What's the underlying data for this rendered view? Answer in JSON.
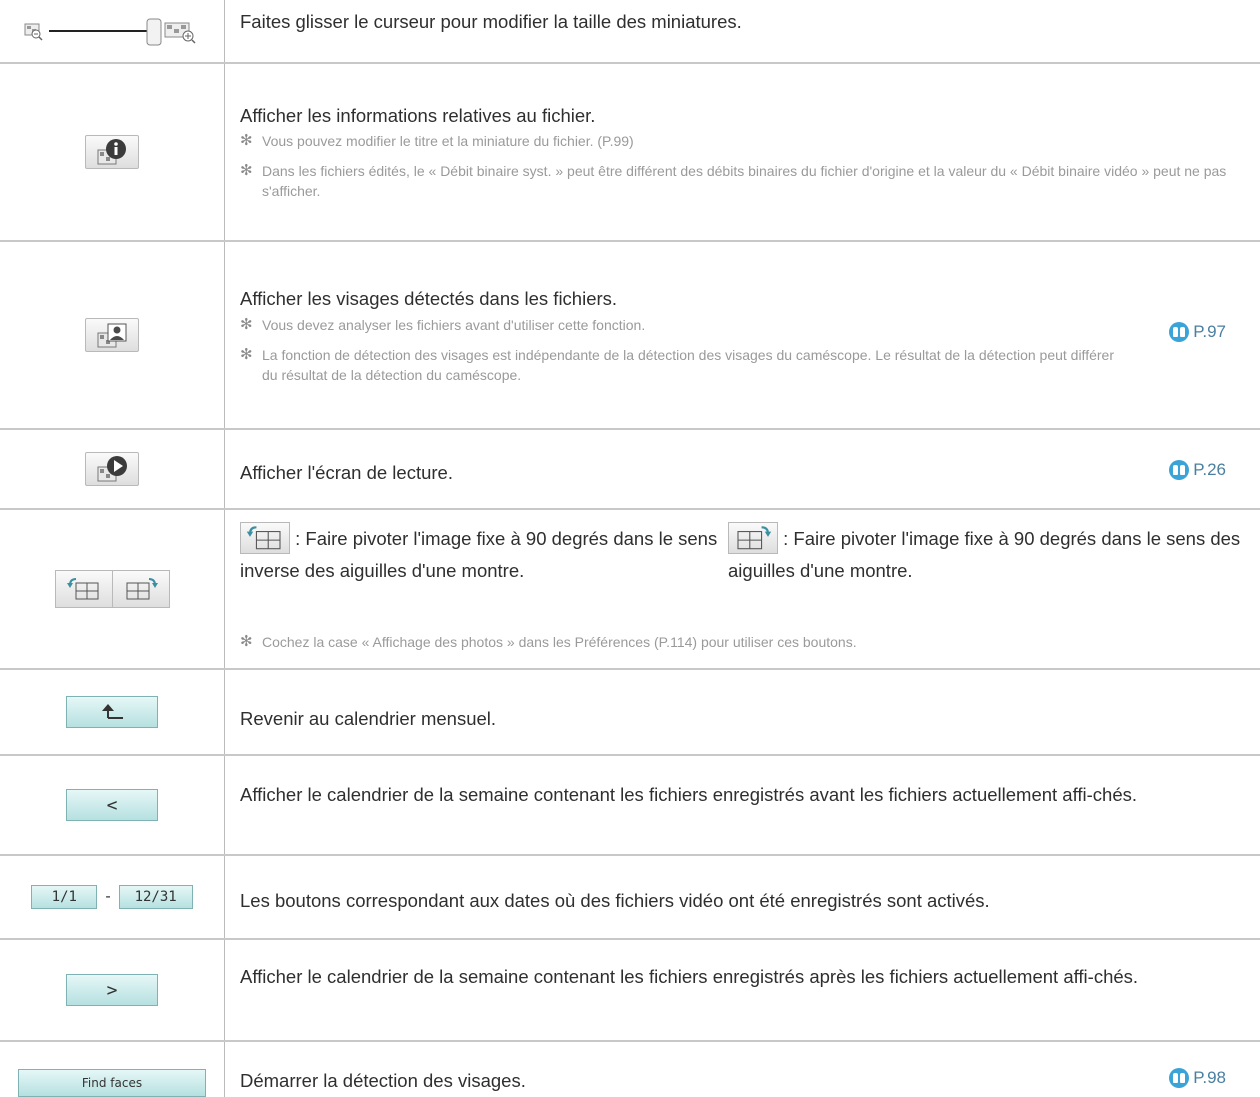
{
  "rows": {
    "slider": {
      "text": "Faites glisser le curseur pour modifier la taille des miniatures."
    },
    "info": {
      "text": "Afficher les informations relatives au fichier.",
      "note1": "Vous pouvez modifier le titre et la miniature du fichier. (P.99)",
      "note2": "Dans les fichiers édités, le « Débit binaire syst. » peut être différent des débits binaires du fichier d'origine et la valeur du « Débit binaire vidéo » peut ne pas s'afficher."
    },
    "faces": {
      "text": "Afficher les visages détectés dans les fichiers.",
      "note1": "Vous devez analyser les fichiers avant d'utiliser cette fonction.",
      "note2": "La fonction de détection des visages est indépendante de la détection des visages du caméscope. Le résultat de la détection peut différer du résultat de la détection du caméscope.",
      "ref": "P.97"
    },
    "playback": {
      "text": "Afficher l'écran de lecture.",
      "ref": "P.26"
    },
    "rotate": {
      "left_text": ": Faire pivoter l'image fixe à 90 degrés dans le sens inverse des aiguilles d'une montre.",
      "right_text": ": Faire pivoter l'image fixe à 90 degrés dans le sens des aiguilles d'une montre.",
      "note": "Cochez la case « Affichage des photos » dans les Préférences (P.114) pour utiliser ces boutons."
    },
    "up": {
      "text": "Revenir au calendrier mensuel."
    },
    "prev": {
      "label": "<",
      "text": "Afficher le calendrier de la semaine contenant les fichiers enregistrés avant les fichiers actuellement affi-chés."
    },
    "dates": {
      "start": "1/1",
      "sep": "-",
      "end": "12/31",
      "text": "Les boutons correspondant aux dates où des fichiers vidéo ont été enregistrés sont activés."
    },
    "next": {
      "label": ">",
      "text": "Afficher le calendrier de la semaine contenant les fichiers enregistrés après les fichiers actuellement affi-chés."
    },
    "findfaces": {
      "label": "Find faces",
      "text": "Démarrer la détection des visages.",
      "ref": "P.98"
    }
  },
  "note_marker": "✻",
  "colors": {
    "accent_blue": "#3aa3d8",
    "button_cyan": "#b6e0e0",
    "divider": "#c8c8c8"
  }
}
